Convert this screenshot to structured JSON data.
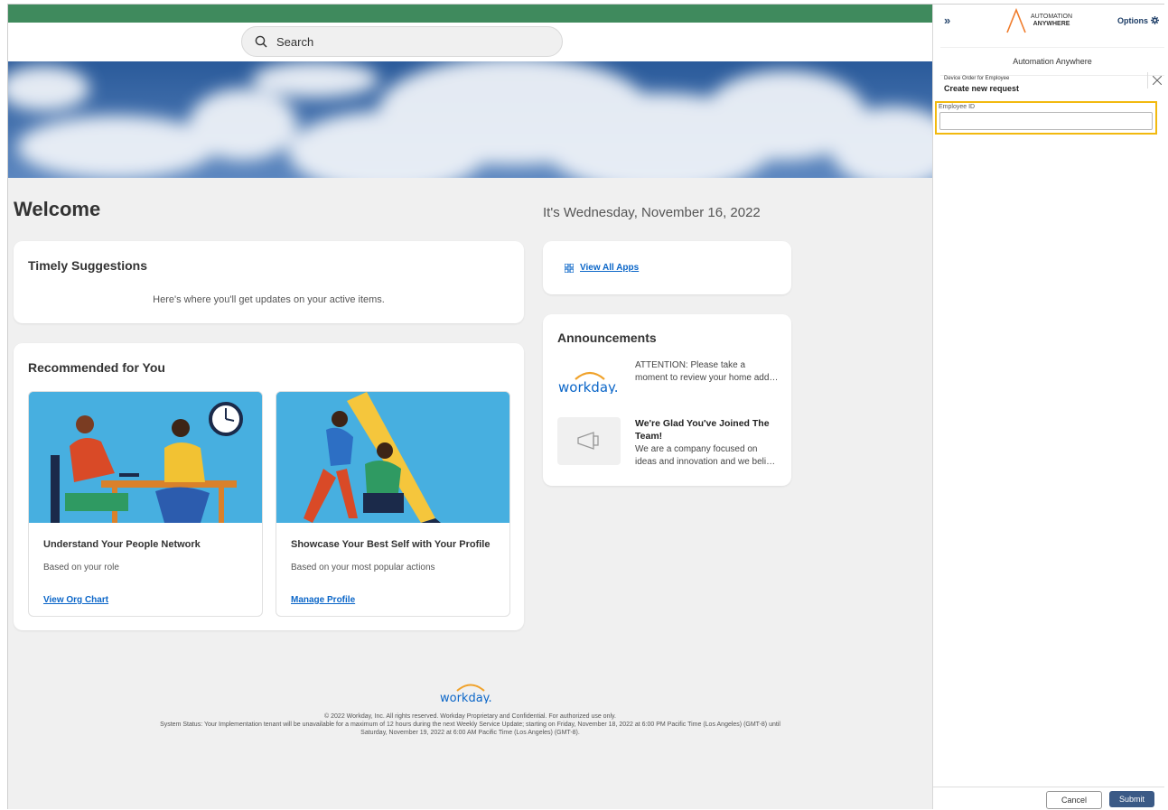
{
  "header": {
    "search_placeholder": "Search"
  },
  "main": {
    "welcome": "Welcome",
    "date": "It's Wednesday, November 16, 2022",
    "timely": {
      "title": "Timely Suggestions",
      "text": "Here's where you'll get updates on your active items."
    },
    "view_all_apps": "View All Apps",
    "recommended": {
      "title": "Recommended for You",
      "cards": [
        {
          "title": "Understand Your People Network",
          "sub": "Based on your role",
          "link": "View Org Chart"
        },
        {
          "title": "Showcase Your Best Self with Your Profile",
          "sub": "Based on your most popular actions",
          "link": "Manage Profile"
        }
      ]
    },
    "announcements": {
      "title": "Announcements",
      "items": [
        {
          "line1": "ATTENTION: Please take a",
          "line2": "moment to review your home add…"
        },
        {
          "title1": "We're Glad You've Joined The",
          "title2": "Team!",
          "line1": "We are a company focused on",
          "line2": "ideas and innovation and we beli…"
        }
      ]
    }
  },
  "footer": {
    "logo": "workday.",
    "copyright": "© 2022 Workday, Inc. All rights reserved. Workday Proprietary and Confidential. For authorized use only.",
    "status1": "System Status: Your Implementation tenant will be unavailable for a maximum of 12 hours during the next Weekly Service Update; starting on Friday, November 18, 2022 at 6:00 PM Pacific Time (Los Angeles) (GMT-8) until",
    "status2": "Saturday, November 19, 2022 at 6:00 AM Pacific Time (Los Angeles) (GMT-8)."
  },
  "panel": {
    "expand": "»",
    "logo_line1": "AUTOMATION",
    "logo_line2": "ANYWHERE",
    "options": "Options",
    "name": "Automation Anywhere",
    "process": "Device Order for Employee",
    "request_title": "Create new request",
    "field_label": "Employee ID",
    "field_value": "",
    "cancel": "Cancel",
    "submit": "Submit"
  },
  "colors": {
    "topbar": "#3f8a5d",
    "link": "#0b66c8",
    "highlight": "#f2b90f",
    "submit": "#3b5a86"
  }
}
